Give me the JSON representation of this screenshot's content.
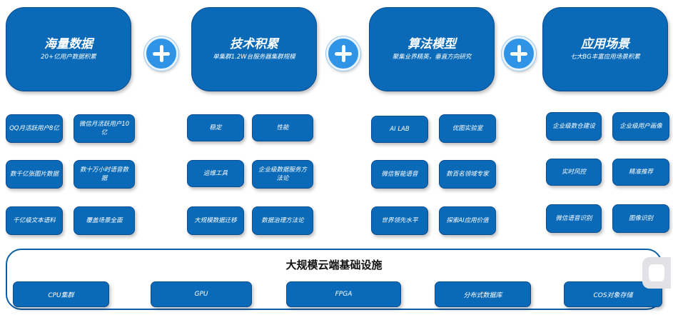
{
  "categories": [
    {
      "title": "海量数据",
      "subtitle": "20+亿用户数据积累"
    },
    {
      "title": "技术积累",
      "subtitle": "单集群1.2W台服务器集群规模"
    },
    {
      "title": "算法模型",
      "subtitle": "聚集业界精英，垂直方向研究"
    },
    {
      "title": "应用场景",
      "subtitle": "七大BG丰富应用场景积累"
    }
  ],
  "data_items": [
    "QQ月活跃用户8亿",
    "微信月活跃用户10亿",
    "数千亿张图片数据",
    "数十万小时语音数据",
    "千亿级文本语料",
    "覆盖场景全面"
  ],
  "tech_items": [
    "稳定",
    "性能",
    "运维工具",
    "企业级数据服务方法论",
    "大规模数据迁移",
    "数据治理方法论"
  ],
  "algo_items": [
    "AI LAB",
    "优图实验室",
    "微信智能语音",
    "数百名领域专家",
    "世界领先水平",
    "探索AI应用价值"
  ],
  "app_items": [
    "企业级数仓建设",
    "企业级用户画像",
    "实时风控",
    "精准推荐",
    "微信语音识别",
    "图像识别"
  ],
  "infrastructure": {
    "title": "大规模云端基础设施",
    "items": [
      "CPU集群",
      "GPU",
      "FPGA",
      "分布式数据库",
      "COS对象存储"
    ]
  }
}
